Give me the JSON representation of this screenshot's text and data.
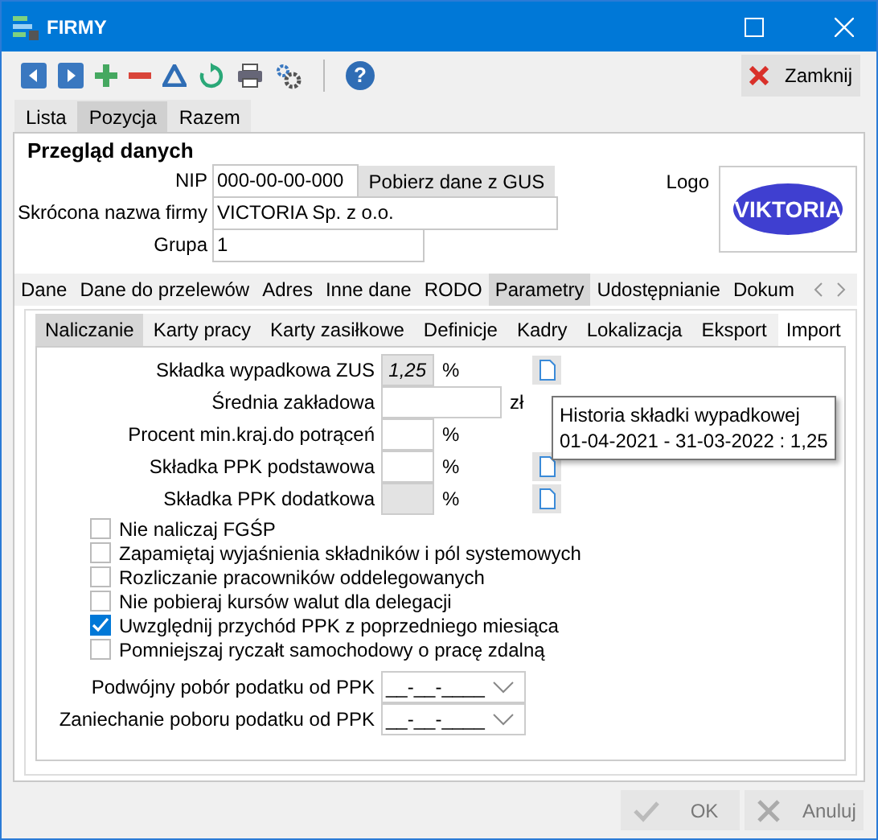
{
  "window": {
    "title": "FIRMY"
  },
  "toolbar": {
    "help": "?",
    "close_button": "Zamknij"
  },
  "view_tabs": [
    {
      "label": "Lista",
      "selected": false
    },
    {
      "label": "Pozycja",
      "selected": true
    },
    {
      "label": "Razem",
      "selected": false
    }
  ],
  "section_title": "Przegląd danych",
  "nip": {
    "label": "NIP",
    "value": "000-00-00-000",
    "action": "Pobierz dane z GUS"
  },
  "short_name": {
    "label": "Skrócona nazwa firmy",
    "value": "VICTORIA Sp. z o.o."
  },
  "group": {
    "label": "Grupa",
    "value": "1"
  },
  "logo": {
    "label": "Logo",
    "text": "VIKTORIA"
  },
  "outer_tabs": [
    {
      "label": "Dane",
      "selected": false
    },
    {
      "label": "Dane do przelewów",
      "selected": false
    },
    {
      "label": "Adres",
      "selected": false
    },
    {
      "label": "Inne dane",
      "selected": false
    },
    {
      "label": "RODO",
      "selected": false
    },
    {
      "label": "Parametry",
      "selected": true
    },
    {
      "label": "Udostępnianie",
      "selected": false
    },
    {
      "label": "Dokum",
      "selected": false
    }
  ],
  "inner_tabs": [
    {
      "label": "Naliczanie",
      "selected": true
    },
    {
      "label": "Karty pracy",
      "selected": false
    },
    {
      "label": "Karty zasiłkowe",
      "selected": false
    },
    {
      "label": "Definicje",
      "selected": false
    },
    {
      "label": "Kadry",
      "selected": false
    },
    {
      "label": "Lokalizacja",
      "selected": false
    },
    {
      "label": "Eksport",
      "selected": false
    },
    {
      "label": "Import",
      "selected": false
    }
  ],
  "params": [
    {
      "label": "Składka wypadkowa ZUS",
      "value": "1,25",
      "unit": "%",
      "kind": "percent",
      "disabled": true,
      "history": true
    },
    {
      "label": "Średnia zakładowa",
      "unit": "zł",
      "kind": "amount",
      "disabled": false,
      "history": false
    },
    {
      "label": "Procent min.kraj.do potrąceń",
      "unit": "%",
      "kind": "percent",
      "disabled": false,
      "history": false
    },
    {
      "label": "Składka PPK podstawowa",
      "unit": "%",
      "kind": "percent",
      "disabled": false,
      "history": true
    },
    {
      "label": "Składka PPK dodatkowa",
      "unit": "%",
      "kind": "percent",
      "disabled": true,
      "history": true
    }
  ],
  "checkboxes": [
    {
      "label": "Nie naliczaj FGŚP",
      "checked": false
    },
    {
      "label": "Zapamiętaj wyjaśnienia składników i pól systemowych",
      "checked": false
    },
    {
      "label": "Rozliczanie pracowników oddelegowanych",
      "checked": false
    },
    {
      "label": "Nie pobieraj kursów walut dla delegacji",
      "checked": false
    },
    {
      "label": "Uwzględnij przychód PPK z poprzedniego miesiąca",
      "checked": true
    },
    {
      "label": "Pomniejszaj ryczałt samochodowy o pracę zdalną",
      "checked": false
    }
  ],
  "date_fields": [
    {
      "label": "Podwójny pobór podatku od PPK",
      "value": "__-__-____"
    },
    {
      "label": "Zaniechanie poboru podatku od PPK",
      "value": "__-__-____"
    }
  ],
  "tooltip": {
    "lines": [
      "Historia składki wypadkowej",
      "01-04-2021 - 31-03-2022 : 1,25"
    ]
  },
  "buttons": [
    {
      "label": "OK",
      "kind": "ok",
      "disabled": true
    },
    {
      "label": "Anuluj",
      "kind": "cancel",
      "disabled": true
    }
  ]
}
